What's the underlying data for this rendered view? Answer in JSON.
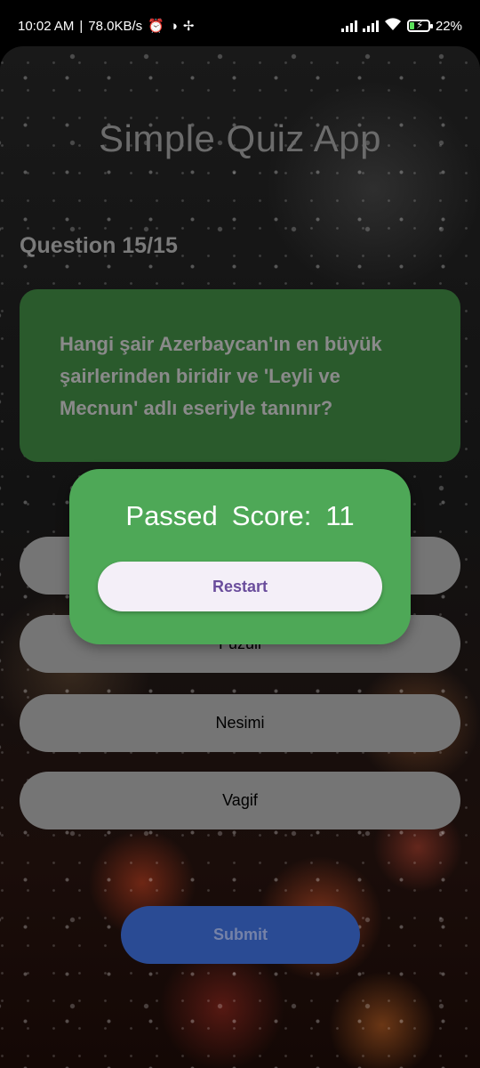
{
  "status_bar": {
    "time": "10:02 AM",
    "network_speed": "78.0KB/s",
    "battery": "22%",
    "icons": [
      "alarm-icon",
      "vpn-icon",
      "fan-icon",
      "signal-icon",
      "signal-icon",
      "wifi-icon",
      "battery-charging-icon"
    ]
  },
  "app": {
    "title": "Simple Quiz App",
    "question_counter": "Question 15/15",
    "question_text": "Hangi şair Azerbaycan'ın en büyük şairlerinden biridir ve 'Leyli ve Mecnun' adlı eseriyle tanınır?",
    "options": [
      {
        "label": ""
      },
      {
        "label": "Fuzuli"
      },
      {
        "label": "Nesimi"
      },
      {
        "label": "Vagif"
      }
    ],
    "submit_label": "Submit"
  },
  "dialog": {
    "status": "Passed",
    "score_label": "Score:",
    "score_value": "11",
    "restart_label": "Restart"
  },
  "colors": {
    "question_card": "#2a5a2c",
    "option_bg": "#757575",
    "submit_bg": "#2a4b94",
    "dialog_bg": "#4ea857",
    "restart_bg": "#f4eff8",
    "restart_text": "#6a4d9c"
  }
}
